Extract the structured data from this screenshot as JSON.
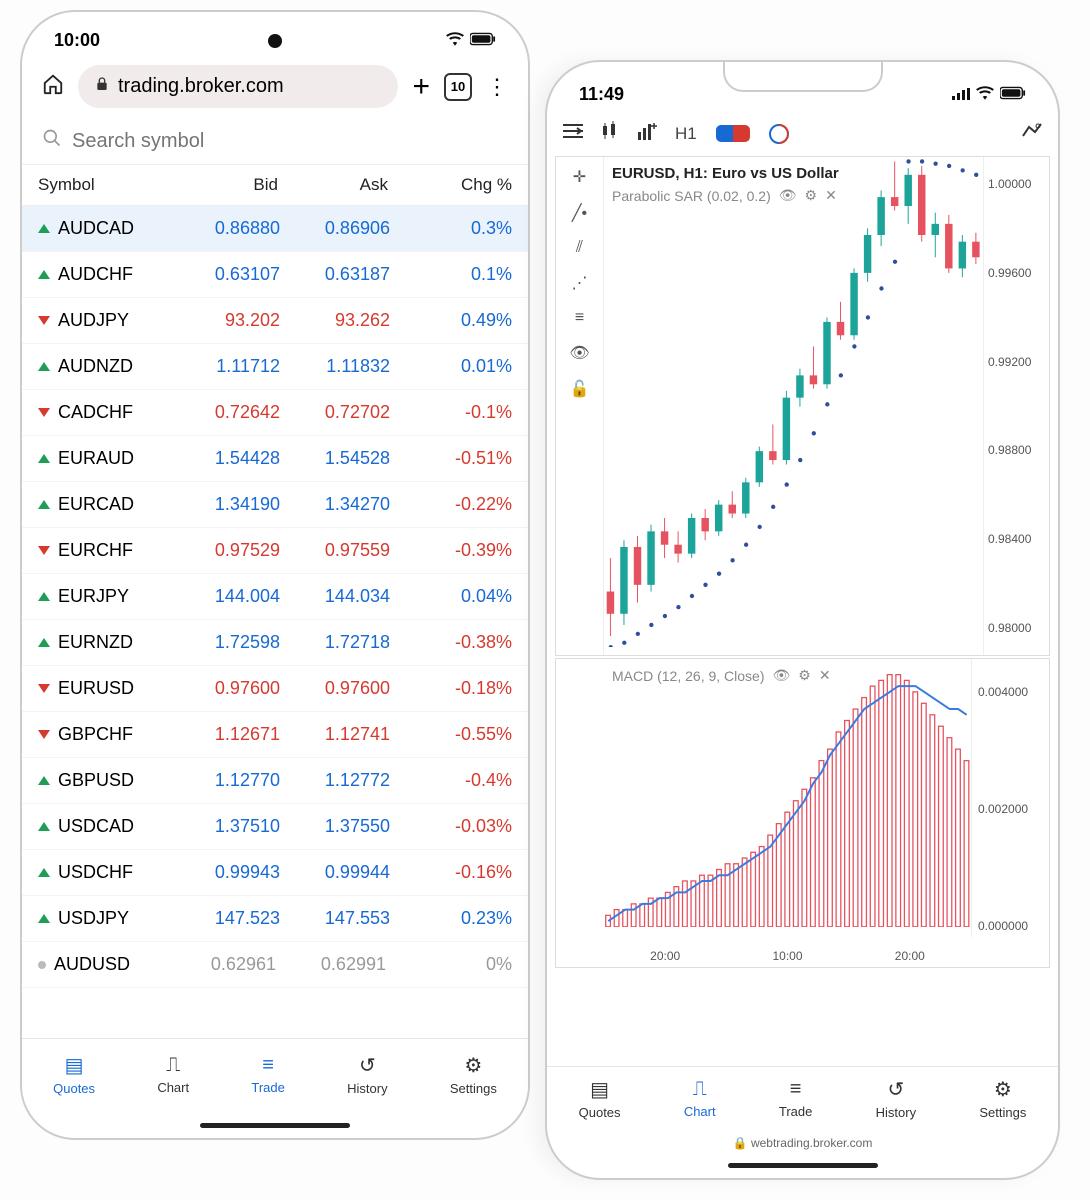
{
  "left": {
    "status_time": "10:00",
    "url": "trading.broker.com",
    "tab_count": "10",
    "search_placeholder": "Search symbol",
    "columns": {
      "c1": "Symbol",
      "c2": "Bid",
      "c3": "Ask",
      "c4": "Chg %"
    },
    "rows": [
      {
        "dir": "up",
        "sym": "AUDCAD",
        "bid": "0.86880",
        "ask": "0.86906",
        "chg": "0.3%",
        "bidc": "blue",
        "askc": "blue",
        "chgc": "blue",
        "hl": true
      },
      {
        "dir": "up",
        "sym": "AUDCHF",
        "bid": "0.63107",
        "ask": "0.63187",
        "chg": "0.1%",
        "bidc": "blue",
        "askc": "blue",
        "chgc": "blue"
      },
      {
        "dir": "down",
        "sym": "AUDJPY",
        "bid": "93.202",
        "ask": "93.262",
        "chg": "0.49%",
        "bidc": "red",
        "askc": "red",
        "chgc": "blue"
      },
      {
        "dir": "up",
        "sym": "AUDNZD",
        "bid": "1.11712",
        "ask": "1.11832",
        "chg": "0.01%",
        "bidc": "blue",
        "askc": "blue",
        "chgc": "blue"
      },
      {
        "dir": "down",
        "sym": "CADCHF",
        "bid": "0.72642",
        "ask": "0.72702",
        "chg": "-0.1%",
        "bidc": "red",
        "askc": "red",
        "chgc": "red"
      },
      {
        "dir": "up",
        "sym": "EURAUD",
        "bid": "1.54428",
        "ask": "1.54528",
        "chg": "-0.51%",
        "bidc": "blue",
        "askc": "blue",
        "chgc": "red"
      },
      {
        "dir": "up",
        "sym": "EURCAD",
        "bid": "1.34190",
        "ask": "1.34270",
        "chg": "-0.22%",
        "bidc": "blue",
        "askc": "blue",
        "chgc": "red"
      },
      {
        "dir": "down",
        "sym": "EURCHF",
        "bid": "0.97529",
        "ask": "0.97559",
        "chg": "-0.39%",
        "bidc": "red",
        "askc": "red",
        "chgc": "red"
      },
      {
        "dir": "up",
        "sym": "EURJPY",
        "bid": "144.004",
        "ask": "144.034",
        "chg": "0.04%",
        "bidc": "blue",
        "askc": "blue",
        "chgc": "blue"
      },
      {
        "dir": "up",
        "sym": "EURNZD",
        "bid": "1.72598",
        "ask": "1.72718",
        "chg": "-0.38%",
        "bidc": "blue",
        "askc": "blue",
        "chgc": "red"
      },
      {
        "dir": "down",
        "sym": "EURUSD",
        "bid": "0.97600",
        "ask": "0.97600",
        "chg": "-0.18%",
        "bidc": "red",
        "askc": "red",
        "chgc": "red"
      },
      {
        "dir": "down",
        "sym": "GBPCHF",
        "bid": "1.12671",
        "ask": "1.12741",
        "chg": "-0.55%",
        "bidc": "red",
        "askc": "red",
        "chgc": "red"
      },
      {
        "dir": "up",
        "sym": "GBPUSD",
        "bid": "1.12770",
        "ask": "1.12772",
        "chg": "-0.4%",
        "bidc": "blue",
        "askc": "blue",
        "chgc": "red"
      },
      {
        "dir": "up",
        "sym": "USDCAD",
        "bid": "1.37510",
        "ask": "1.37550",
        "chg": "-0.03%",
        "bidc": "blue",
        "askc": "blue",
        "chgc": "red"
      },
      {
        "dir": "up",
        "sym": "USDCHF",
        "bid": "0.99943",
        "ask": "0.99944",
        "chg": "-0.16%",
        "bidc": "blue",
        "askc": "blue",
        "chgc": "red"
      },
      {
        "dir": "up",
        "sym": "USDJPY",
        "bid": "147.523",
        "ask": "147.553",
        "chg": "0.23%",
        "bidc": "blue",
        "askc": "blue",
        "chgc": "blue"
      },
      {
        "dir": "flat",
        "sym": "AUDUSD",
        "bid": "0.62961",
        "ask": "0.62991",
        "chg": "0%",
        "bidc": "grey",
        "askc": "grey",
        "chgc": "grey"
      }
    ],
    "nav": [
      {
        "id": "quotes",
        "label": "Quotes",
        "glyph": "▤",
        "active": true
      },
      {
        "id": "chart",
        "label": "Chart",
        "glyph": "⎍"
      },
      {
        "id": "trade",
        "label": "Trade",
        "glyph": "≡",
        "active": true
      },
      {
        "id": "history",
        "label": "History",
        "glyph": "↺"
      },
      {
        "id": "settings",
        "label": "Settings",
        "glyph": "⚙"
      }
    ]
  },
  "right": {
    "status_time": "11:49",
    "toolbar": {
      "timeframe": "H1"
    },
    "chart": {
      "title": "EURUSD, H1: Euro vs US Dollar",
      "indicator_label": "Parabolic SAR (0.02, 0.2)",
      "y_ticks": [
        "1.00000",
        "0.99600",
        "0.99200",
        "0.98800",
        "0.98400",
        "0.98000"
      ],
      "macd_label": "MACD (12, 26, 9, Close)",
      "macd_y_ticks": [
        "0.004000",
        "0.002000",
        "0.000000"
      ],
      "x_ticks": [
        "20:00",
        "10:00",
        "20:00"
      ]
    },
    "addr": "webtrading.broker.com",
    "nav": [
      {
        "id": "quotes",
        "label": "Quotes",
        "glyph": "▤"
      },
      {
        "id": "chart",
        "label": "Chart",
        "glyph": "⎍",
        "active": true
      },
      {
        "id": "trade",
        "label": "Trade",
        "glyph": "≡"
      },
      {
        "id": "history",
        "label": "History",
        "glyph": "↺"
      },
      {
        "id": "settings",
        "label": "Settings",
        "glyph": "⚙"
      }
    ]
  },
  "chart_data": {
    "type": "candlestick",
    "symbol": "EURUSD",
    "timeframe": "H1",
    "y_range": [
      0.978,
      1.0
    ],
    "candles": [
      {
        "o": 0.9805,
        "h": 0.982,
        "l": 0.9785,
        "c": 0.9795,
        "color": "red"
      },
      {
        "o": 0.9795,
        "h": 0.9828,
        "l": 0.979,
        "c": 0.9825,
        "color": "green"
      },
      {
        "o": 0.9825,
        "h": 0.983,
        "l": 0.98,
        "c": 0.9808,
        "color": "red"
      },
      {
        "o": 0.9808,
        "h": 0.9835,
        "l": 0.9805,
        "c": 0.9832,
        "color": "green"
      },
      {
        "o": 0.9832,
        "h": 0.9838,
        "l": 0.982,
        "c": 0.9826,
        "color": "red"
      },
      {
        "o": 0.9826,
        "h": 0.9832,
        "l": 0.9818,
        "c": 0.9822,
        "color": "red"
      },
      {
        "o": 0.9822,
        "h": 0.984,
        "l": 0.982,
        "c": 0.9838,
        "color": "green"
      },
      {
        "o": 0.9838,
        "h": 0.9842,
        "l": 0.9828,
        "c": 0.9832,
        "color": "red"
      },
      {
        "o": 0.9832,
        "h": 0.9846,
        "l": 0.983,
        "c": 0.9844,
        "color": "green"
      },
      {
        "o": 0.9844,
        "h": 0.985,
        "l": 0.9838,
        "c": 0.984,
        "color": "red"
      },
      {
        "o": 0.984,
        "h": 0.9856,
        "l": 0.9838,
        "c": 0.9854,
        "color": "green"
      },
      {
        "o": 0.9854,
        "h": 0.987,
        "l": 0.9852,
        "c": 0.9868,
        "color": "green"
      },
      {
        "o": 0.9868,
        "h": 0.988,
        "l": 0.9862,
        "c": 0.9864,
        "color": "red"
      },
      {
        "o": 0.9864,
        "h": 0.9895,
        "l": 0.9862,
        "c": 0.9892,
        "color": "green"
      },
      {
        "o": 0.9892,
        "h": 0.9905,
        "l": 0.9888,
        "c": 0.9902,
        "color": "green"
      },
      {
        "o": 0.9902,
        "h": 0.9915,
        "l": 0.9896,
        "c": 0.9898,
        "color": "red"
      },
      {
        "o": 0.9898,
        "h": 0.9928,
        "l": 0.9896,
        "c": 0.9926,
        "color": "green"
      },
      {
        "o": 0.9926,
        "h": 0.9935,
        "l": 0.9918,
        "c": 0.992,
        "color": "red"
      },
      {
        "o": 0.992,
        "h": 0.995,
        "l": 0.9918,
        "c": 0.9948,
        "color": "green"
      },
      {
        "o": 0.9948,
        "h": 0.9968,
        "l": 0.9944,
        "c": 0.9965,
        "color": "green"
      },
      {
        "o": 0.9965,
        "h": 0.9985,
        "l": 0.996,
        "c": 0.9982,
        "color": "green"
      },
      {
        "o": 0.9982,
        "h": 0.9998,
        "l": 0.9976,
        "c": 0.9978,
        "color": "red"
      },
      {
        "o": 0.9978,
        "h": 0.9995,
        "l": 0.997,
        "c": 0.9992,
        "color": "green"
      },
      {
        "o": 0.9992,
        "h": 0.9996,
        "l": 0.9962,
        "c": 0.9965,
        "color": "red"
      },
      {
        "o": 0.9965,
        "h": 0.9975,
        "l": 0.9955,
        "c": 0.997,
        "color": "green"
      },
      {
        "o": 0.997,
        "h": 0.9974,
        "l": 0.9948,
        "c": 0.995,
        "color": "red"
      },
      {
        "o": 0.995,
        "h": 0.9965,
        "l": 0.9946,
        "c": 0.9962,
        "color": "green"
      },
      {
        "o": 0.9962,
        "h": 0.9966,
        "l": 0.9952,
        "c": 0.9955,
        "color": "red"
      }
    ],
    "parabolic_sar": [
      0.978,
      0.9782,
      0.9786,
      0.979,
      0.9794,
      0.9798,
      0.9803,
      0.9808,
      0.9813,
      0.9819,
      0.9826,
      0.9834,
      0.9843,
      0.9853,
      0.9864,
      0.9876,
      0.9889,
      0.9902,
      0.9915,
      0.9928,
      0.9941,
      0.9953,
      0.9998,
      0.9998,
      0.9997,
      0.9996,
      0.9994,
      0.9992
    ],
    "macd": {
      "y_range": [
        0,
        0.0045
      ],
      "histogram": [
        0.0002,
        0.0003,
        0.0003,
        0.0004,
        0.0004,
        0.0005,
        0.0005,
        0.0006,
        0.0007,
        0.0008,
        0.0008,
        0.0009,
        0.0009,
        0.001,
        0.0011,
        0.0011,
        0.0012,
        0.0013,
        0.0014,
        0.0016,
        0.0018,
        0.002,
        0.0022,
        0.0024,
        0.0026,
        0.0029,
        0.0031,
        0.0034,
        0.0036,
        0.0038,
        0.004,
        0.0042,
        0.0043,
        0.0044,
        0.0044,
        0.0043,
        0.0041,
        0.0039,
        0.0037,
        0.0035,
        0.0033,
        0.0031,
        0.0029
      ],
      "signal": [
        0.0001,
        0.0002,
        0.0003,
        0.0003,
        0.0004,
        0.0004,
        0.0005,
        0.0005,
        0.0006,
        0.0006,
        0.0007,
        0.0008,
        0.0008,
        0.0009,
        0.0009,
        0.001,
        0.0011,
        0.0012,
        0.0013,
        0.0014,
        0.0016,
        0.0018,
        0.002,
        0.0022,
        0.0025,
        0.0027,
        0.003,
        0.0032,
        0.0034,
        0.0036,
        0.0038,
        0.0039,
        0.004,
        0.0041,
        0.0042,
        0.0042,
        0.0042,
        0.0041,
        0.004,
        0.0039,
        0.0038,
        0.0038,
        0.0037
      ]
    }
  }
}
